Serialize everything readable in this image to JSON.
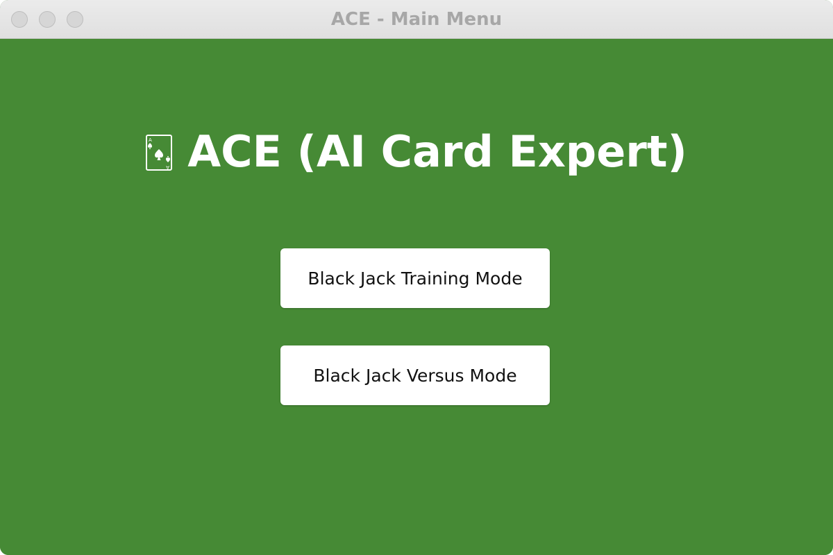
{
  "window": {
    "title": "ACE - Main Menu"
  },
  "main": {
    "title": "ACE (AI Card Expert)",
    "title_icon": "playing-card-ace-of-spades-icon"
  },
  "buttons": {
    "training_label": "Black Jack Training Mode",
    "versus_label": "Black Jack Versus Mode"
  },
  "colors": {
    "table_green": "#468a35",
    "button_background": "#ffffff",
    "title_text": "#ffffff",
    "titlebar_text": "#a7a7a7"
  }
}
